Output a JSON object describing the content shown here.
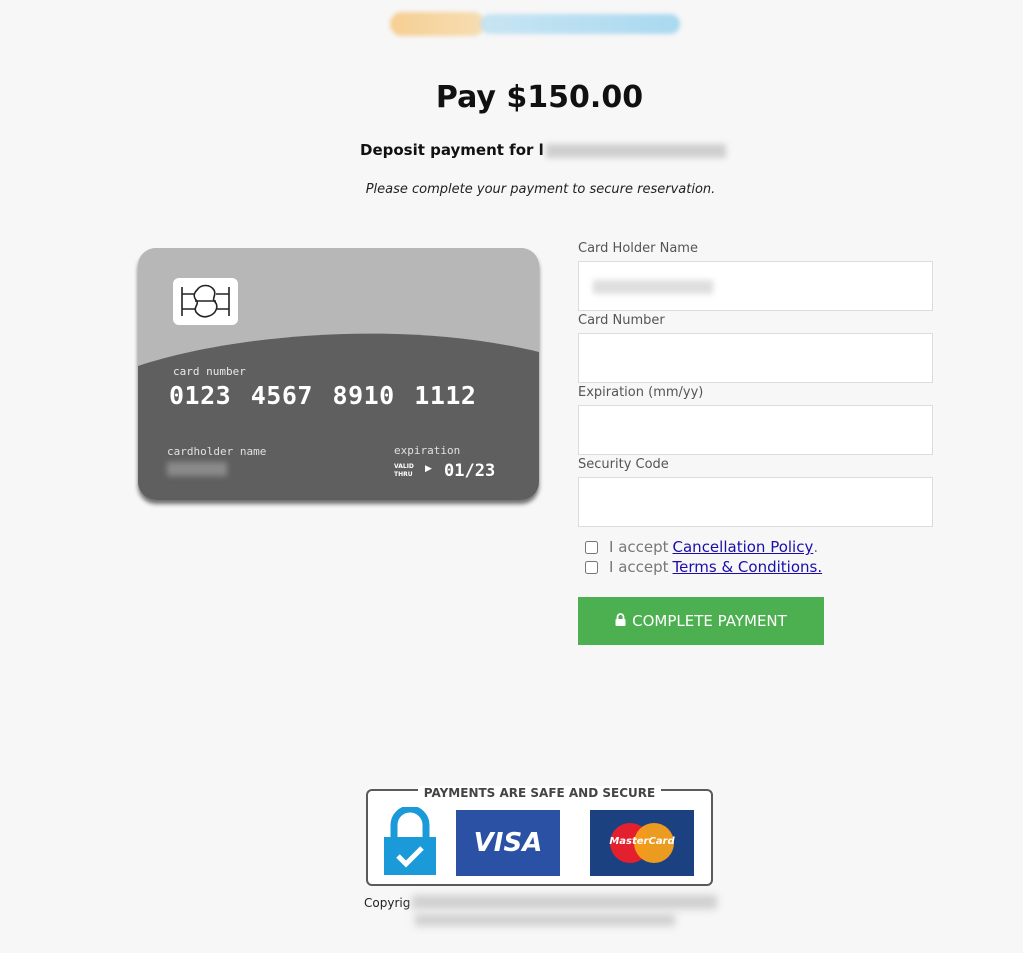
{
  "header": {
    "title": "Pay $150.00",
    "subtitle_prefix": "Deposit payment for l",
    "note": "Please complete your payment to secure reservation."
  },
  "card_preview": {
    "number_label": "card number",
    "number": "0123 4567 8910 1112",
    "holder_label": "cardholder name",
    "expiration_label": "expiration",
    "valid_thru_1": "VALID",
    "valid_thru_2": "THRU",
    "expiration": "01/23"
  },
  "form": {
    "holder_label": "Card Holder Name",
    "number_label": "Card Number",
    "expiration_label": "Expiration (mm/yy)",
    "security_label": "Security Code",
    "accept_text": "I accept",
    "cancellation_link": "Cancellation Policy",
    "cancellation_suffix": ".",
    "terms_link": "Terms & Conditions.",
    "submit_label": "COMPLETE PAYMENT"
  },
  "footer": {
    "badge_title": "PAYMENTS ARE SAFE AND SECURE",
    "visa_label": "VISA",
    "mastercard_label": "MasterCard",
    "copyright_prefix": "Copyrig"
  },
  "colors": {
    "button": "#4caf50",
    "link": "#1a0dab",
    "card_top": "#b7b7b7",
    "card_bottom": "#5f5f5f",
    "visa_bg": "#2a51a3",
    "mastercard_bg": "#1c4180",
    "lock_icon": "#1a9ad9"
  }
}
